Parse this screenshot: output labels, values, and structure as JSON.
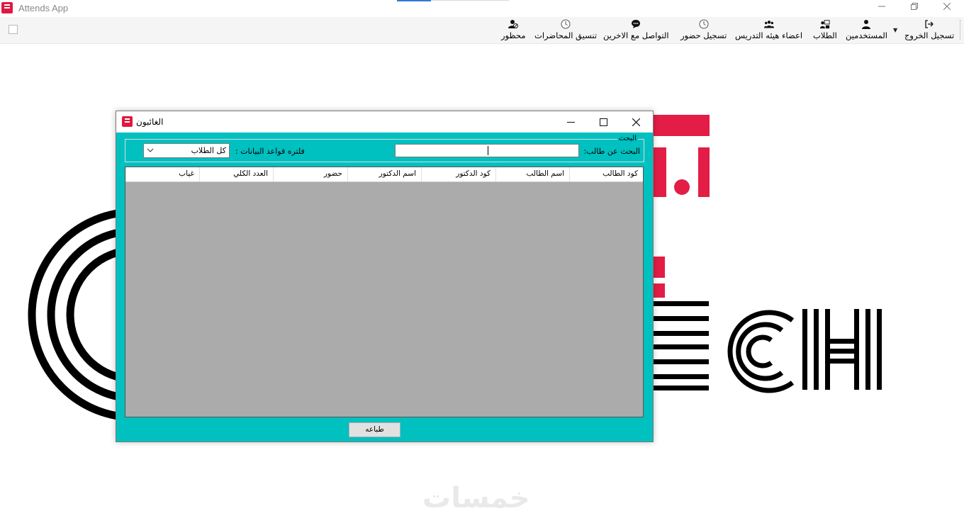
{
  "window": {
    "title": "Attends App",
    "minimize_icon": "minimize-icon",
    "restore_icon": "restore-icon",
    "close_icon": "close-icon"
  },
  "toolbar": {
    "items": [
      {
        "label": "تسجيل الخروج",
        "icon": "logout-icon"
      },
      {
        "label": "المستخدمين",
        "icon": "user-icon"
      },
      {
        "label": "الطلاب",
        "icon": "students-icon"
      },
      {
        "label": "اعضاء هيئه التدريس",
        "icon": "group-icon"
      },
      {
        "label": "تسجيل حضور",
        "icon": "clock-icon"
      },
      {
        "label": "التواصل مع الاخرين",
        "icon": "chat-icon"
      },
      {
        "label": "تنسيق المحاضرات",
        "icon": "clock-icon"
      },
      {
        "label": "محظور",
        "icon": "blocked-user-icon"
      }
    ]
  },
  "background": {
    "logo_text": "ECH",
    "watermark": "خمسات"
  },
  "dialog": {
    "title": "الغائبون",
    "search_group_title": "البحث",
    "search_label": "البحث عن طالب:",
    "search_value": "",
    "filter_label": "فلتره قواعد البيانات :",
    "filter_selected": "كل الطلاب",
    "columns": [
      "كود الطالب",
      "اسم الطالب",
      "كود الدكتور",
      "اسم الدكتور",
      "حضور",
      "العدد الكلي",
      "غياب"
    ],
    "print_label": "طباعه"
  },
  "colors": {
    "dialog_bg": "#00c0c0",
    "grid_bg": "#ababab",
    "brand_red": "#e0193f"
  }
}
